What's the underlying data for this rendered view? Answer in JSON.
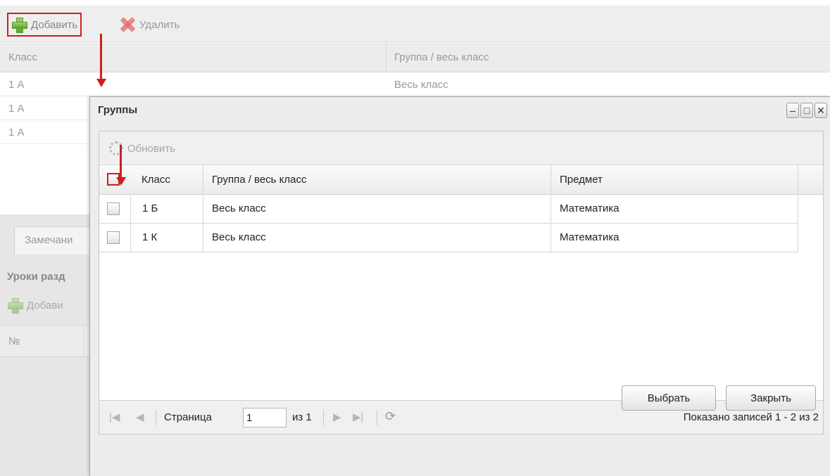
{
  "background": {
    "toolbar": {
      "add_label": "Добавить",
      "delete_label": "Удалить"
    },
    "columns": [
      "Класс",
      "Группа / весь класс"
    ],
    "rows": [
      {
        "class": "1 А",
        "group": "Весь класс"
      },
      {
        "class": "1 А",
        "group": ""
      },
      {
        "class": "1 А",
        "group": ""
      }
    ],
    "tab_label": "Замечани",
    "section_title": "Уроки разд",
    "section_add_label": "Добави",
    "number_column": "№"
  },
  "dialog": {
    "title": "Группы",
    "controls": {
      "minimize": "‒",
      "maximize": "□",
      "close": "✕"
    },
    "refresh_label": "Обновить",
    "columns": {
      "class": "Класс",
      "group": "Группа / весь класс",
      "subject": "Предмет"
    },
    "rows": [
      {
        "class": "1 Б",
        "group": "Весь класс",
        "subject": "Математика"
      },
      {
        "class": "1 К",
        "group": "Весь класс",
        "subject": "Математика"
      }
    ],
    "paging": {
      "page_label": "Страница",
      "page_value": "1",
      "of_label": "из 1",
      "info": "Показано записей 1 - 2 из 2"
    },
    "select_button": "Выбрать",
    "close_button": "Закрыть"
  },
  "colors": {
    "annotation": "#cc1f1f"
  }
}
